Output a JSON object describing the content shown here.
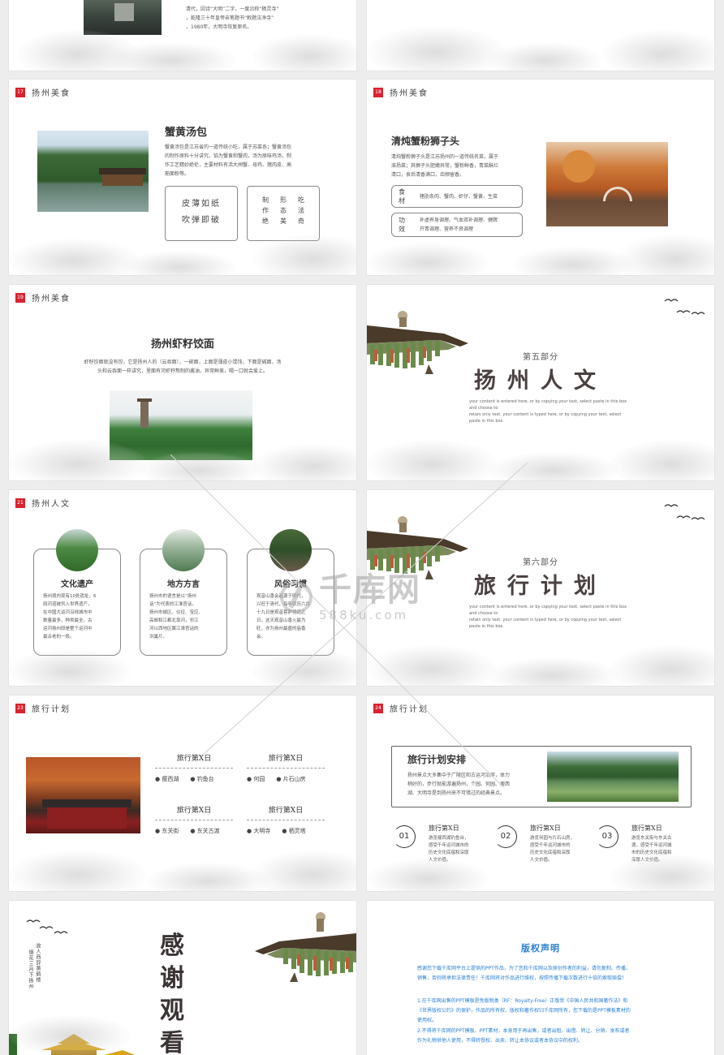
{
  "slide1": {
    "text": [
      "清代，因诗“大明”二字，一度沿称“栖灵寺”",
      "，乾隆三十年皇帝亲笔题书“敕题法净寺”",
      "，1980年，大明寺恢复原名。"
    ]
  },
  "slide3": {
    "num": "17",
    "section": "扬州美食",
    "title": "蟹黄汤包",
    "text": [
      "蟹黄汤包是江苏省的一道传统小吃，属于苏菜系；蟹黄汤包",
      "的制作原料十分讲究，馅为蟹黄和蟹肉，汤为原味鸡汤，制",
      "作工艺精妙绝伦，主要材料有活大闸蟹、母鸡、猪肉皮、高",
      "筋面粉等。"
    ],
    "box1": [
      "皮薄如纸",
      "吹弹即破"
    ],
    "box2_cols": [
      [
        "制",
        "作",
        "绝"
      ],
      [
        "形",
        "态",
        "美"
      ],
      [
        "吃",
        "法",
        "奇"
      ]
    ]
  },
  "slide4": {
    "num": "18",
    "section": "扬州美食",
    "title": "清炖蟹粉狮子头",
    "text": [
      "清炖蟹粉狮子头是江苏扬州的一道传统名菜，属于",
      "淮扬菜；其狮子头肥嫩异常，蟹粉鲜香，青菜酥烂",
      "清口，食后清香满口，齿颊留香。"
    ],
    "row1_label": [
      "食",
      "材"
    ],
    "row1_text": "猪肋条肉、蟹肉、虾仔、蟹黄、生菜",
    "row2_label": [
      "功",
      "效"
    ],
    "row2_text": [
      "补虚养身调理、气血双补调理、健脾",
      "开胃调理、营养不良调理"
    ]
  },
  "slide5": {
    "num": "19",
    "section": "扬州美食",
    "title": "扬州虾籽饺面",
    "text": [
      "虾籽饺面就没有饺，它是扬州人的（云吞面），一碗面，上面是薄皮小馄饨，下面是碱面，汤",
      "头和云吞面一样讲究，里面有河虾籽熬制的酱油，异常鲜美，喝一口就会爱上。"
    ]
  },
  "slide6": {
    "label": "第五部分",
    "title": "扬州人文",
    "en": [
      "your content is entered here, or by copying your text, select paste in this box and choose to",
      "retain only text. your content is typed here, or by copying your text, select paste in this box."
    ]
  },
  "slide7": {
    "num": "21",
    "section": "扬州人文",
    "cards": [
      {
        "title": "文化遗产",
        "text": [
          "扬州境内现有10处遗址，6",
          "段河道被列入世界遗产，",
          "在中国大运河沿线城市中",
          "数量最多，种类最全，古",
          "运河扬州段是整个运河中",
          "最古老的一段。"
        ]
      },
      {
        "title": "地方方言",
        "text": [
          "扬州市的语言是以“扬州",
          "话”为代表的江淮官话，",
          "扬州市城区、仪征、宝应、",
          "高邮和江都北靠河，邗江",
          "河以西地区属江淮官话的",
          "洪巢片。"
        ]
      },
      {
        "title": "风俗习惯",
        "text": [
          "观音山香会起源于明代，",
          "兴旺于清代，每年农历六月",
          "十九日是观音菩萨得道之",
          "日，这天观音山香火最为",
          "旺，亦为扬州最盛的庙香",
          "会。"
        ]
      }
    ]
  },
  "slide8": {
    "label": "第六部分",
    "title": "旅行计划",
    "en": [
      "your content is entered here, or by copying your text, select paste in this box and choose to",
      "retain only text. your content is typed here, or by copying your text, select paste in this box."
    ]
  },
  "slide9": {
    "num": "23",
    "section": "旅行计划",
    "days": [
      {
        "title": "旅行第X日",
        "items": [
          "瘦西湖",
          "钓鱼台"
        ]
      },
      {
        "title": "旅行第X日",
        "items": [
          "何园",
          "片石山房"
        ]
      },
      {
        "title": "旅行第X日",
        "items": [
          "东关街",
          "东关古渡"
        ]
      },
      {
        "title": "旅行第X日",
        "items": [
          "大明寺",
          "栖灵塔"
        ]
      }
    ]
  },
  "slide10": {
    "num": "24",
    "section": "旅行计划",
    "title": "旅行计划安排",
    "text": [
      "扬州景点大多集中于广陵区和古运河沿岸，体力",
      "稍好的，步行就能游遍扬州，个园、何园、瘦西",
      "湖、大明寺是到扬州来不可错过的经典景点。"
    ],
    "steps": [
      {
        "num": "01",
        "title": "旅行第X日",
        "text": [
          "游览瘦西湖钓鱼台，",
          "感受千年运河城市的",
          "历史文化底蕴和深厚",
          "人文价值。"
        ]
      },
      {
        "num": "02",
        "title": "旅行第X日",
        "text": [
          "游览何园与片石山房，",
          "感受千年运河城市的",
          "历史文化底蕴和深厚",
          "人文价值。"
        ]
      },
      {
        "num": "03",
        "title": "旅行第X日",
        "text": [
          "游览东关街与东关古",
          "渡，感受千年运河城",
          "市的历史文化底蕴和",
          "深厚人文价值。"
        ]
      }
    ]
  },
  "slide11": {
    "vertical1": "故人西辞黄鹤楼",
    "vertical2": "烟花三月下扬州",
    "thanks": [
      "感",
      "谢",
      "观",
      "看"
    ]
  },
  "slide12": {
    "title": "版权声明",
    "p1": [
      "感谢您下载千库网平台上提供的PPT作品，为了您和千库网以及原创作者的利益，请勿复制、传播、",
      "销售，否则将承担法律责任！千库网将对作品进行维权，按照传播下载次数进行十倍的索取赔偿！"
    ],
    "p2": [
      "1.在千库网出售的PPT模板是免版税类（RF：Royalty-Free）正版受《中国人民共和国著作法》和",
      "《世界版权公约》的保护，作品的所有权、版权和著作权归千库网所有，您下载的是PPT模板素材的",
      "使用权。"
    ],
    "p3": [
      "2.不得将千库网的PPT模板、PPT素材，本身用于再出售，或者出租、出借、转让、分销、发布或者",
      "作为礼物供他人使用，不得转授权、出卖、转让本协议或者本协议中的权利。"
    ]
  },
  "watermark": {
    "main": "千库网",
    "sub": "588ku.com"
  },
  "colors": {
    "accent": "#d9232e",
    "blue": "#2a7fd4",
    "text": "#333333"
  }
}
